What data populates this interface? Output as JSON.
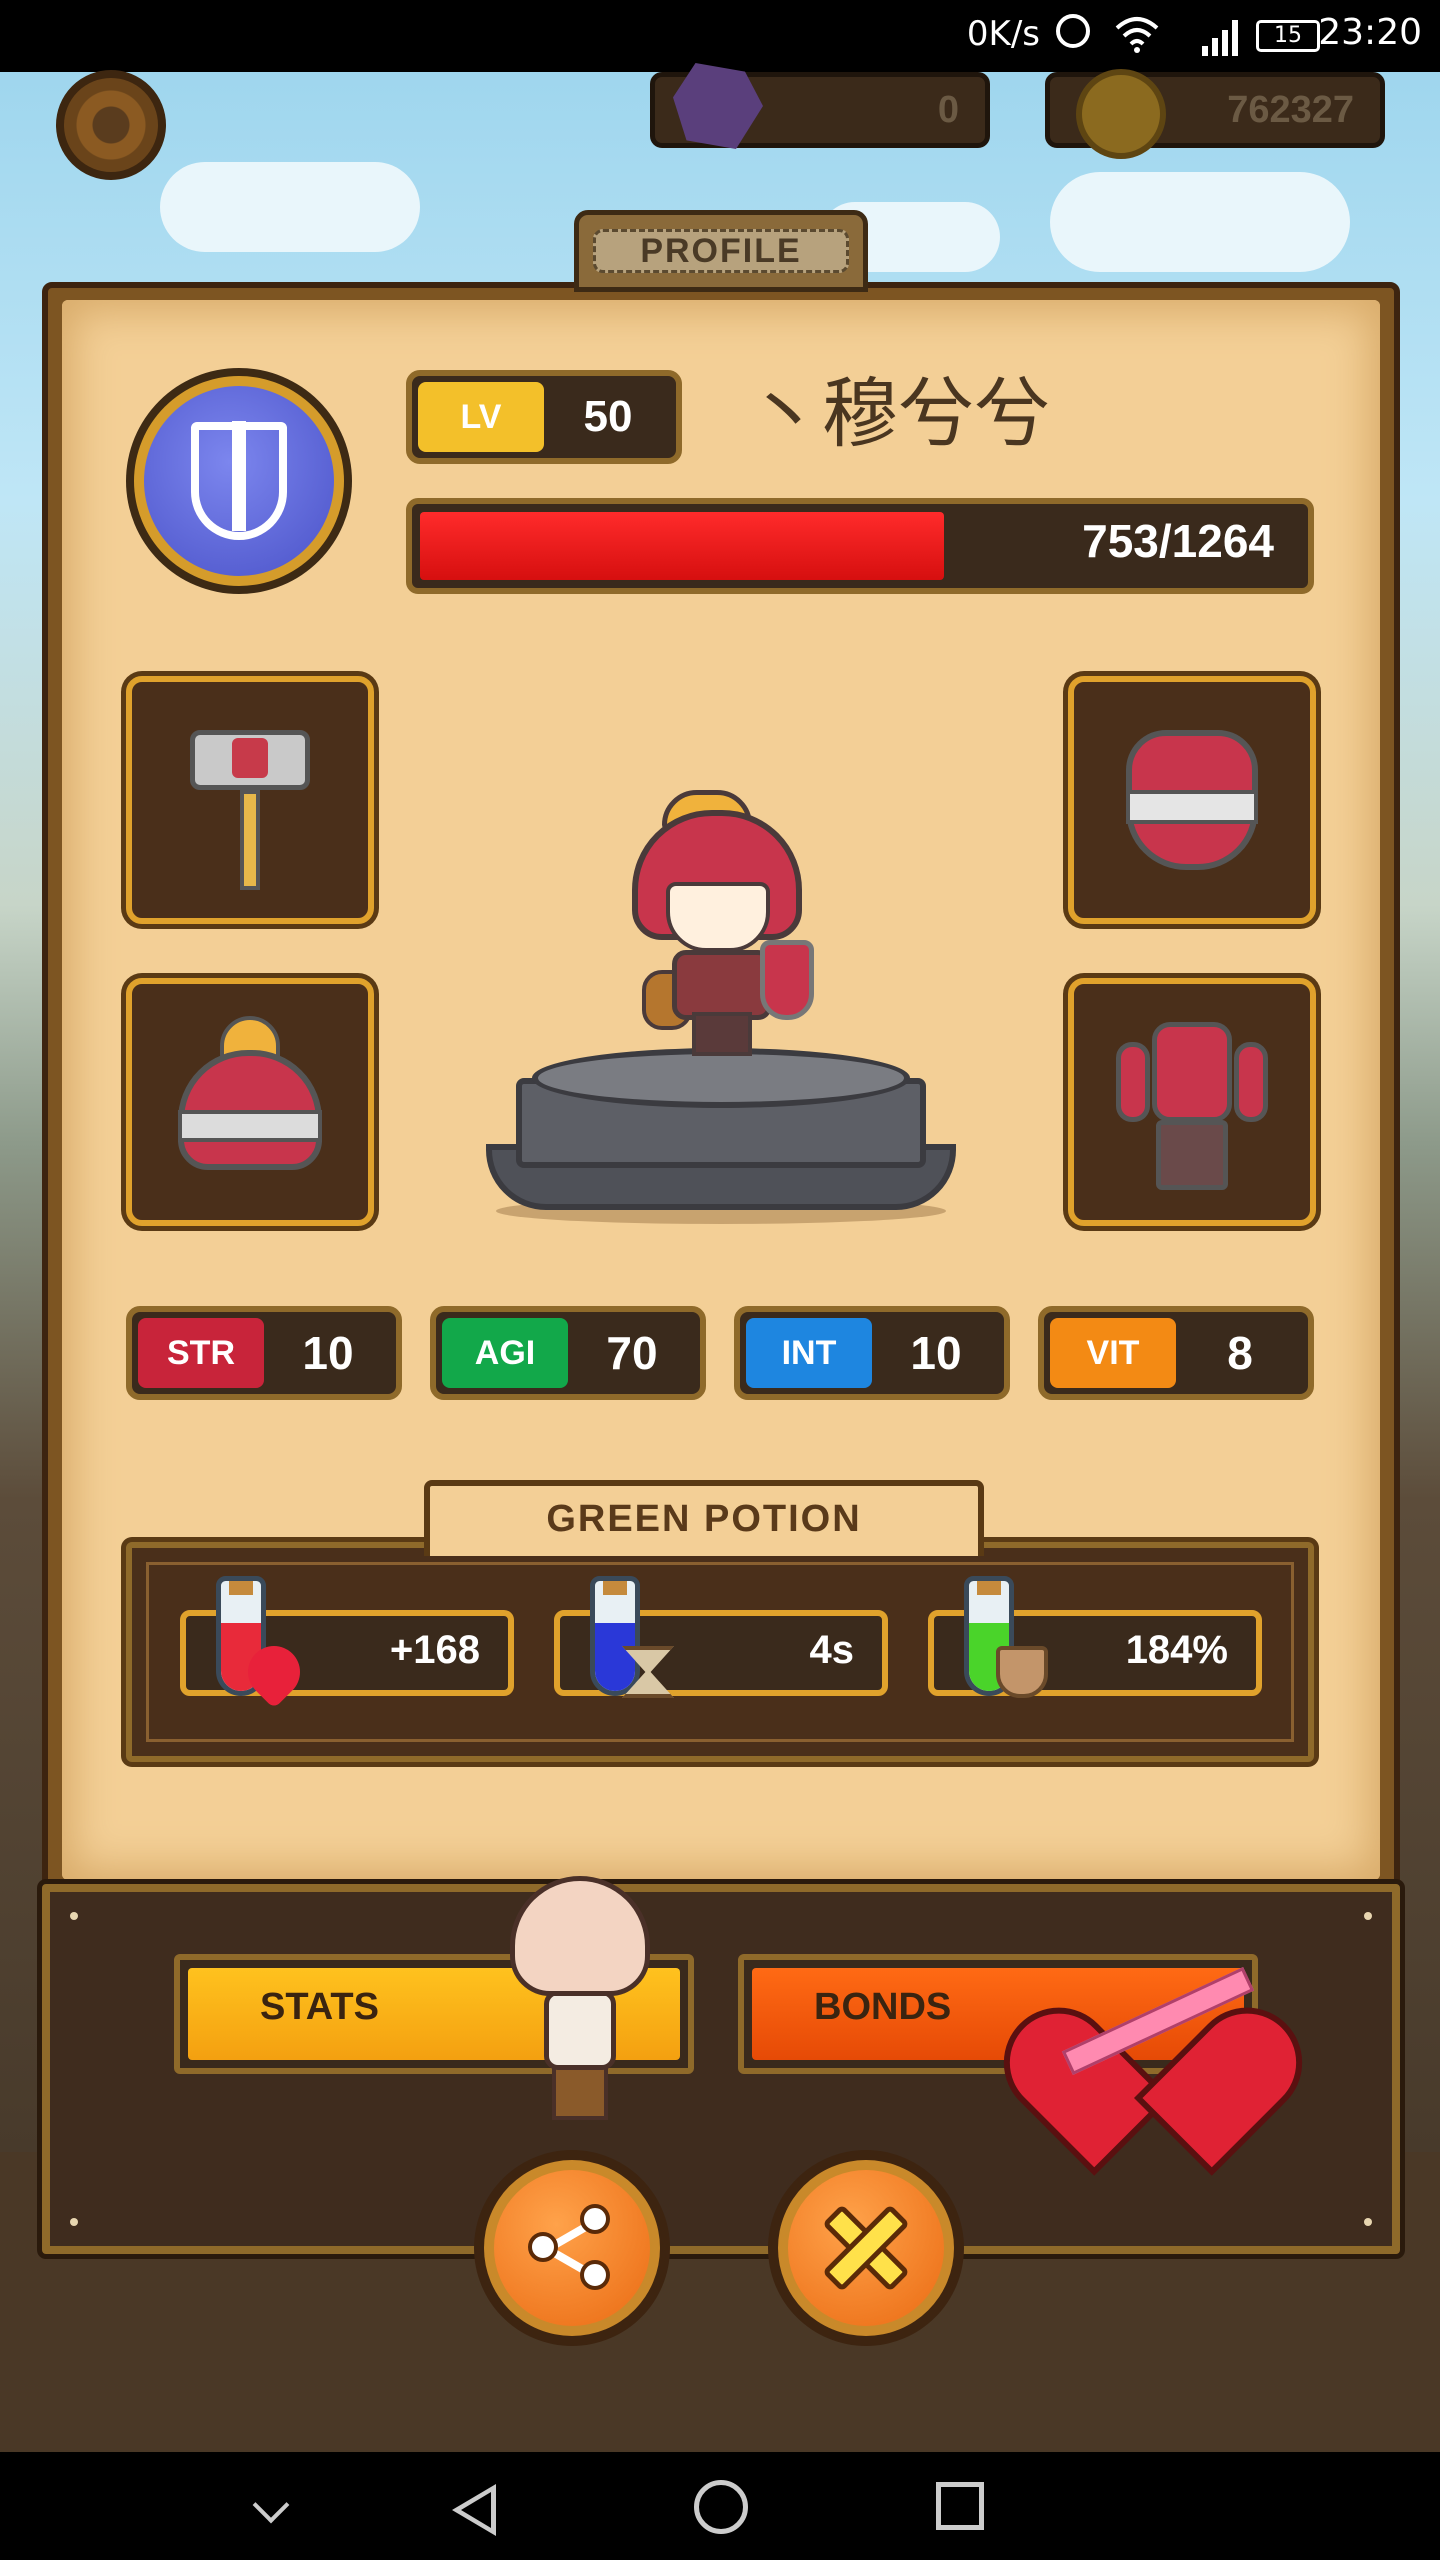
{
  "status_bar": {
    "network_speed": "0K/s",
    "battery": "15",
    "time": "23:20",
    "icons": [
      "alarm-icon",
      "wifi-icon",
      "signal-icon",
      "battery-icon"
    ]
  },
  "currencies": {
    "gems": "0",
    "gold": "762327"
  },
  "profile": {
    "tab_label": "PROFILE",
    "level_label": "LV",
    "level": "50",
    "name": "丶穆兮兮",
    "hp_text": "753/1264",
    "hp_current": 753,
    "hp_max": 1264
  },
  "equipment": [
    {
      "slot": "weapon",
      "icon": "hammer-icon"
    },
    {
      "slot": "helmet",
      "icon": "helmet-icon"
    },
    {
      "slot": "armor",
      "icon": "breastplate-icon"
    },
    {
      "slot": "outfit",
      "icon": "outfit-icon"
    }
  ],
  "stats": [
    {
      "label": "STR",
      "value": "10",
      "color": "#c8243a"
    },
    {
      "label": "AGI",
      "value": "70",
      "color": "#12a84a"
    },
    {
      "label": "INT",
      "value": "10",
      "color": "#1e86e0"
    },
    {
      "label": "VIT",
      "value": "8",
      "color": "#f38a14"
    }
  ],
  "potion": {
    "title": "GREEN POTION",
    "effects": [
      {
        "icon": "heal-potion-icon",
        "value": "+168"
      },
      {
        "icon": "time-potion-icon",
        "value": "4s"
      },
      {
        "icon": "defense-potion-icon",
        "value": "184%"
      }
    ]
  },
  "bottom": {
    "stats_tab": "STATS",
    "bonds_tab": "BONDS"
  },
  "colors": {
    "hp_fill": "#ff2b2b",
    "gold_border": "#e0a22c",
    "paper": "#f3cf96"
  }
}
